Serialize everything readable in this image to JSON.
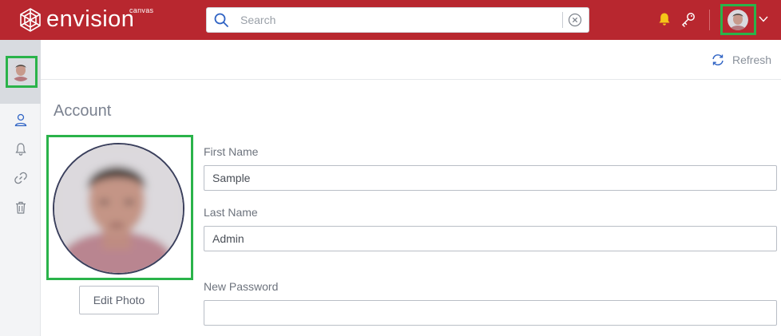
{
  "header": {
    "logo_text": "envision",
    "logo_subtext": "canvas",
    "search_placeholder": "Search"
  },
  "toolbar": {
    "refresh_label": "Refresh"
  },
  "account": {
    "title": "Account",
    "edit_photo_label": "Edit Photo",
    "fields": [
      {
        "label": "First Name",
        "value": "Sample"
      },
      {
        "label": "Last Name",
        "value": "Admin"
      },
      {
        "label": "New Password",
        "value": ""
      }
    ]
  },
  "icons": {
    "brand": "envision-logo-icon",
    "search": "search-icon",
    "clear": "clear-search-icon",
    "notifications": "bell-icon",
    "key": "key-icon",
    "menu": "chevron-down-icon",
    "rail": [
      "user-icon",
      "bell-outline-icon",
      "link-icon",
      "trash-icon"
    ],
    "refresh": "refresh-icon"
  },
  "colors": {
    "brand_red": "#b8272f",
    "highlight_green": "#2ab34a",
    "bell_yellow": "#f5c518",
    "accent_blue": "#2f63c4"
  }
}
